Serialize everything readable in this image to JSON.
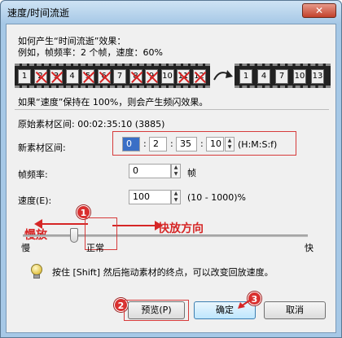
{
  "window": {
    "title": "速度/时间流逝",
    "close_label": "✕"
  },
  "info": {
    "line1": "如何产生“时间流逝”效果：",
    "line2": "例如，帧频率：2 个帧，速度：60%"
  },
  "film_original": [
    "1",
    "2",
    "3",
    "4",
    "5",
    "6",
    "7",
    "8",
    "9",
    "10",
    "11",
    "12"
  ],
  "film_dropped_indices": [
    1,
    2,
    4,
    5,
    7,
    8,
    10,
    11
  ],
  "film_result": [
    "1",
    "4",
    "7",
    "10",
    "13"
  ],
  "note_flicker": "如果“速度”保持在 100%，则会产生频闪效果。",
  "original_range": "原始素材区间: 00:02:35:10 (3885)",
  "new_range": {
    "label": "新素材区间:",
    "h": "0",
    "m": "2",
    "s": "35",
    "f": "10",
    "format": "(H:M:S:f)"
  },
  "frame_rate": {
    "label": "帧频率:",
    "value": "0",
    "unit": "帧"
  },
  "speed": {
    "label": "速度(E):",
    "value": "100",
    "range": "(10 - 1000)%"
  },
  "slider": {
    "slow_label": "慢",
    "normal_label": "正常",
    "fast_label": "快",
    "position_fraction": 0.18
  },
  "annotations": {
    "slow_play": "慢放",
    "fast_direction": "快放方向",
    "badge1": "1",
    "badge2": "2",
    "badge3": "3"
  },
  "tip": "按住 [Shift] 然后拖动素材的终点，可以改变回放速度。",
  "buttons": {
    "preview": "预览(P)",
    "ok": "确定",
    "cancel": "取消"
  },
  "colors": {
    "annotation_red": "#d62626",
    "window_frame": "#a6c8e6"
  }
}
